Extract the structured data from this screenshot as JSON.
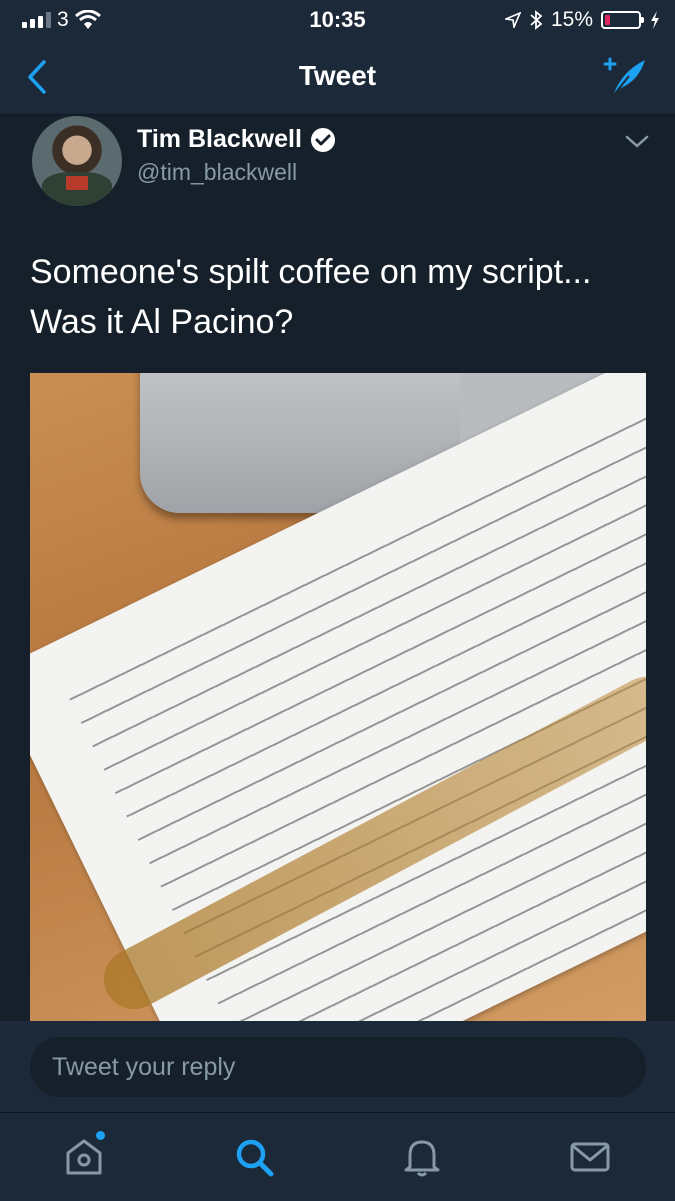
{
  "status_bar": {
    "carrier": "3",
    "time": "10:35",
    "battery": "15%",
    "battery_level": 0.15,
    "icons": [
      "signal-icon",
      "wifi-icon",
      "location-arrow-icon",
      "bluetooth-icon",
      "battery-icon",
      "charging-bolt-icon"
    ]
  },
  "nav": {
    "title": "Tweet",
    "back_icon": "chevron-left-icon",
    "compose_icon": "compose-tweet-icon"
  },
  "tweet": {
    "author_name": "Tim Blackwell",
    "author_handle": "@tim_blackwell",
    "verified": true,
    "text_line1": "Someone's spilt coffee on my script...",
    "text_line2": "Was it Al Pacino?"
  },
  "reply": {
    "placeholder": "Tweet your reply"
  },
  "tabs": [
    {
      "icon": "home-icon",
      "notification_dot": true
    },
    {
      "icon": "search-icon",
      "active": true
    },
    {
      "icon": "notifications-bell-icon"
    },
    {
      "icon": "messages-envelope-icon"
    }
  ],
  "colors": {
    "background": "#15202b",
    "bar": "#1c2938",
    "accent": "#1da1f2",
    "secondary_text": "#8899a6"
  }
}
